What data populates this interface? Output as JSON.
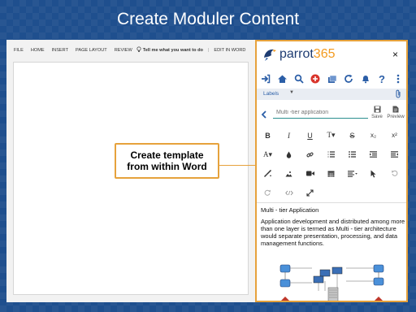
{
  "slide": {
    "title": "Create Moduler Content"
  },
  "word": {
    "ribbon_tabs": [
      "FILE",
      "HOME",
      "INSERT",
      "PAGE LAYOUT",
      "REVIEW"
    ],
    "tell_me": "Tell me what you want to do",
    "edit_in_word": "EDIT IN WORD"
  },
  "callout": {
    "line1": "Create template",
    "line2": "from within Word"
  },
  "addin": {
    "brand_prefix": "parrot",
    "brand_suffix": "365",
    "close": "×",
    "labels_tab": "Labels",
    "title_placeholder": "Multi -tier application",
    "save_label": "Save",
    "preview_label": "Preview",
    "toolbar_icons": [
      "sign-in-icon",
      "home-icon",
      "search-icon",
      "add-icon",
      "stack-icon",
      "refresh-icon",
      "bell-icon",
      "help-icon",
      "more-vertical-icon"
    ],
    "format_buttons": [
      [
        "B",
        "I",
        "U",
        "T▾",
        "S",
        "x₂",
        "x²"
      ],
      [
        "A▾",
        "drop",
        "link",
        "list-num",
        "list-bullet",
        "outdent",
        "indent"
      ],
      [
        "brush",
        "image",
        "video",
        "table",
        "align▾",
        "cursor",
        "undo"
      ],
      [
        "redo",
        "code",
        "expand"
      ]
    ],
    "content": {
      "heading": "Multi - tier Application",
      "paragraph": "Application development and distributed among more than one layer is termed as Multi - tier architecture would separate presentation, processing, and data management functions."
    },
    "colors": {
      "accent": "#e6a23c",
      "brand_blue": "#1e3c72",
      "brand_orange": "#f39a1f",
      "icon_blue": "#2b5ea7",
      "red": "#d9342b"
    }
  }
}
